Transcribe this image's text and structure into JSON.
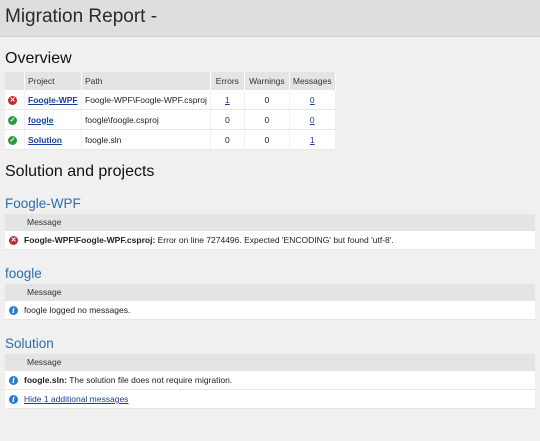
{
  "window": {
    "title": "Migration Report -"
  },
  "overview": {
    "heading": "Overview",
    "columns": [
      "Project",
      "Path",
      "Errors",
      "Warnings",
      "Messages"
    ],
    "rows": [
      {
        "status": "error",
        "project": "Foogle-WPF",
        "path": "Foogle-WPF\\Foogle-WPF.csproj",
        "errors": "1",
        "warnings": "0",
        "messages": "0"
      },
      {
        "status": "ok",
        "project": "foogle",
        "path": "foogle\\foogle.csproj",
        "errors": "0",
        "warnings": "0",
        "messages": "0"
      },
      {
        "status": "ok",
        "project": "Solution",
        "path": "foogle.sln",
        "errors": "0",
        "warnings": "0",
        "messages": "1"
      }
    ]
  },
  "details": {
    "heading": "Solution and projects",
    "message_col": "Message",
    "projects": [
      {
        "name": "Foogle-WPF",
        "messages": [
          {
            "icon": "error",
            "source": "Foogle-WPF\\Foogle-WPF.csproj:",
            "text": " Error on line 7274496. Expected 'ENCODING' but found 'utf-8'."
          }
        ]
      },
      {
        "name": "foogle",
        "messages": [
          {
            "icon": "info",
            "source": "",
            "text": "foogle logged no messages."
          }
        ]
      },
      {
        "name": "Solution",
        "messages": [
          {
            "icon": "info",
            "source": "foogle.sln:",
            "text": " The solution file does not require migration."
          }
        ],
        "hide_link": "Hide 1 additional messages"
      }
    ]
  },
  "colors": {
    "link": "#1a3e9c",
    "project_heading": "#2a6eb0",
    "error": "#c0282d",
    "ok": "#2e9a3e",
    "info": "#2a7ccf"
  }
}
